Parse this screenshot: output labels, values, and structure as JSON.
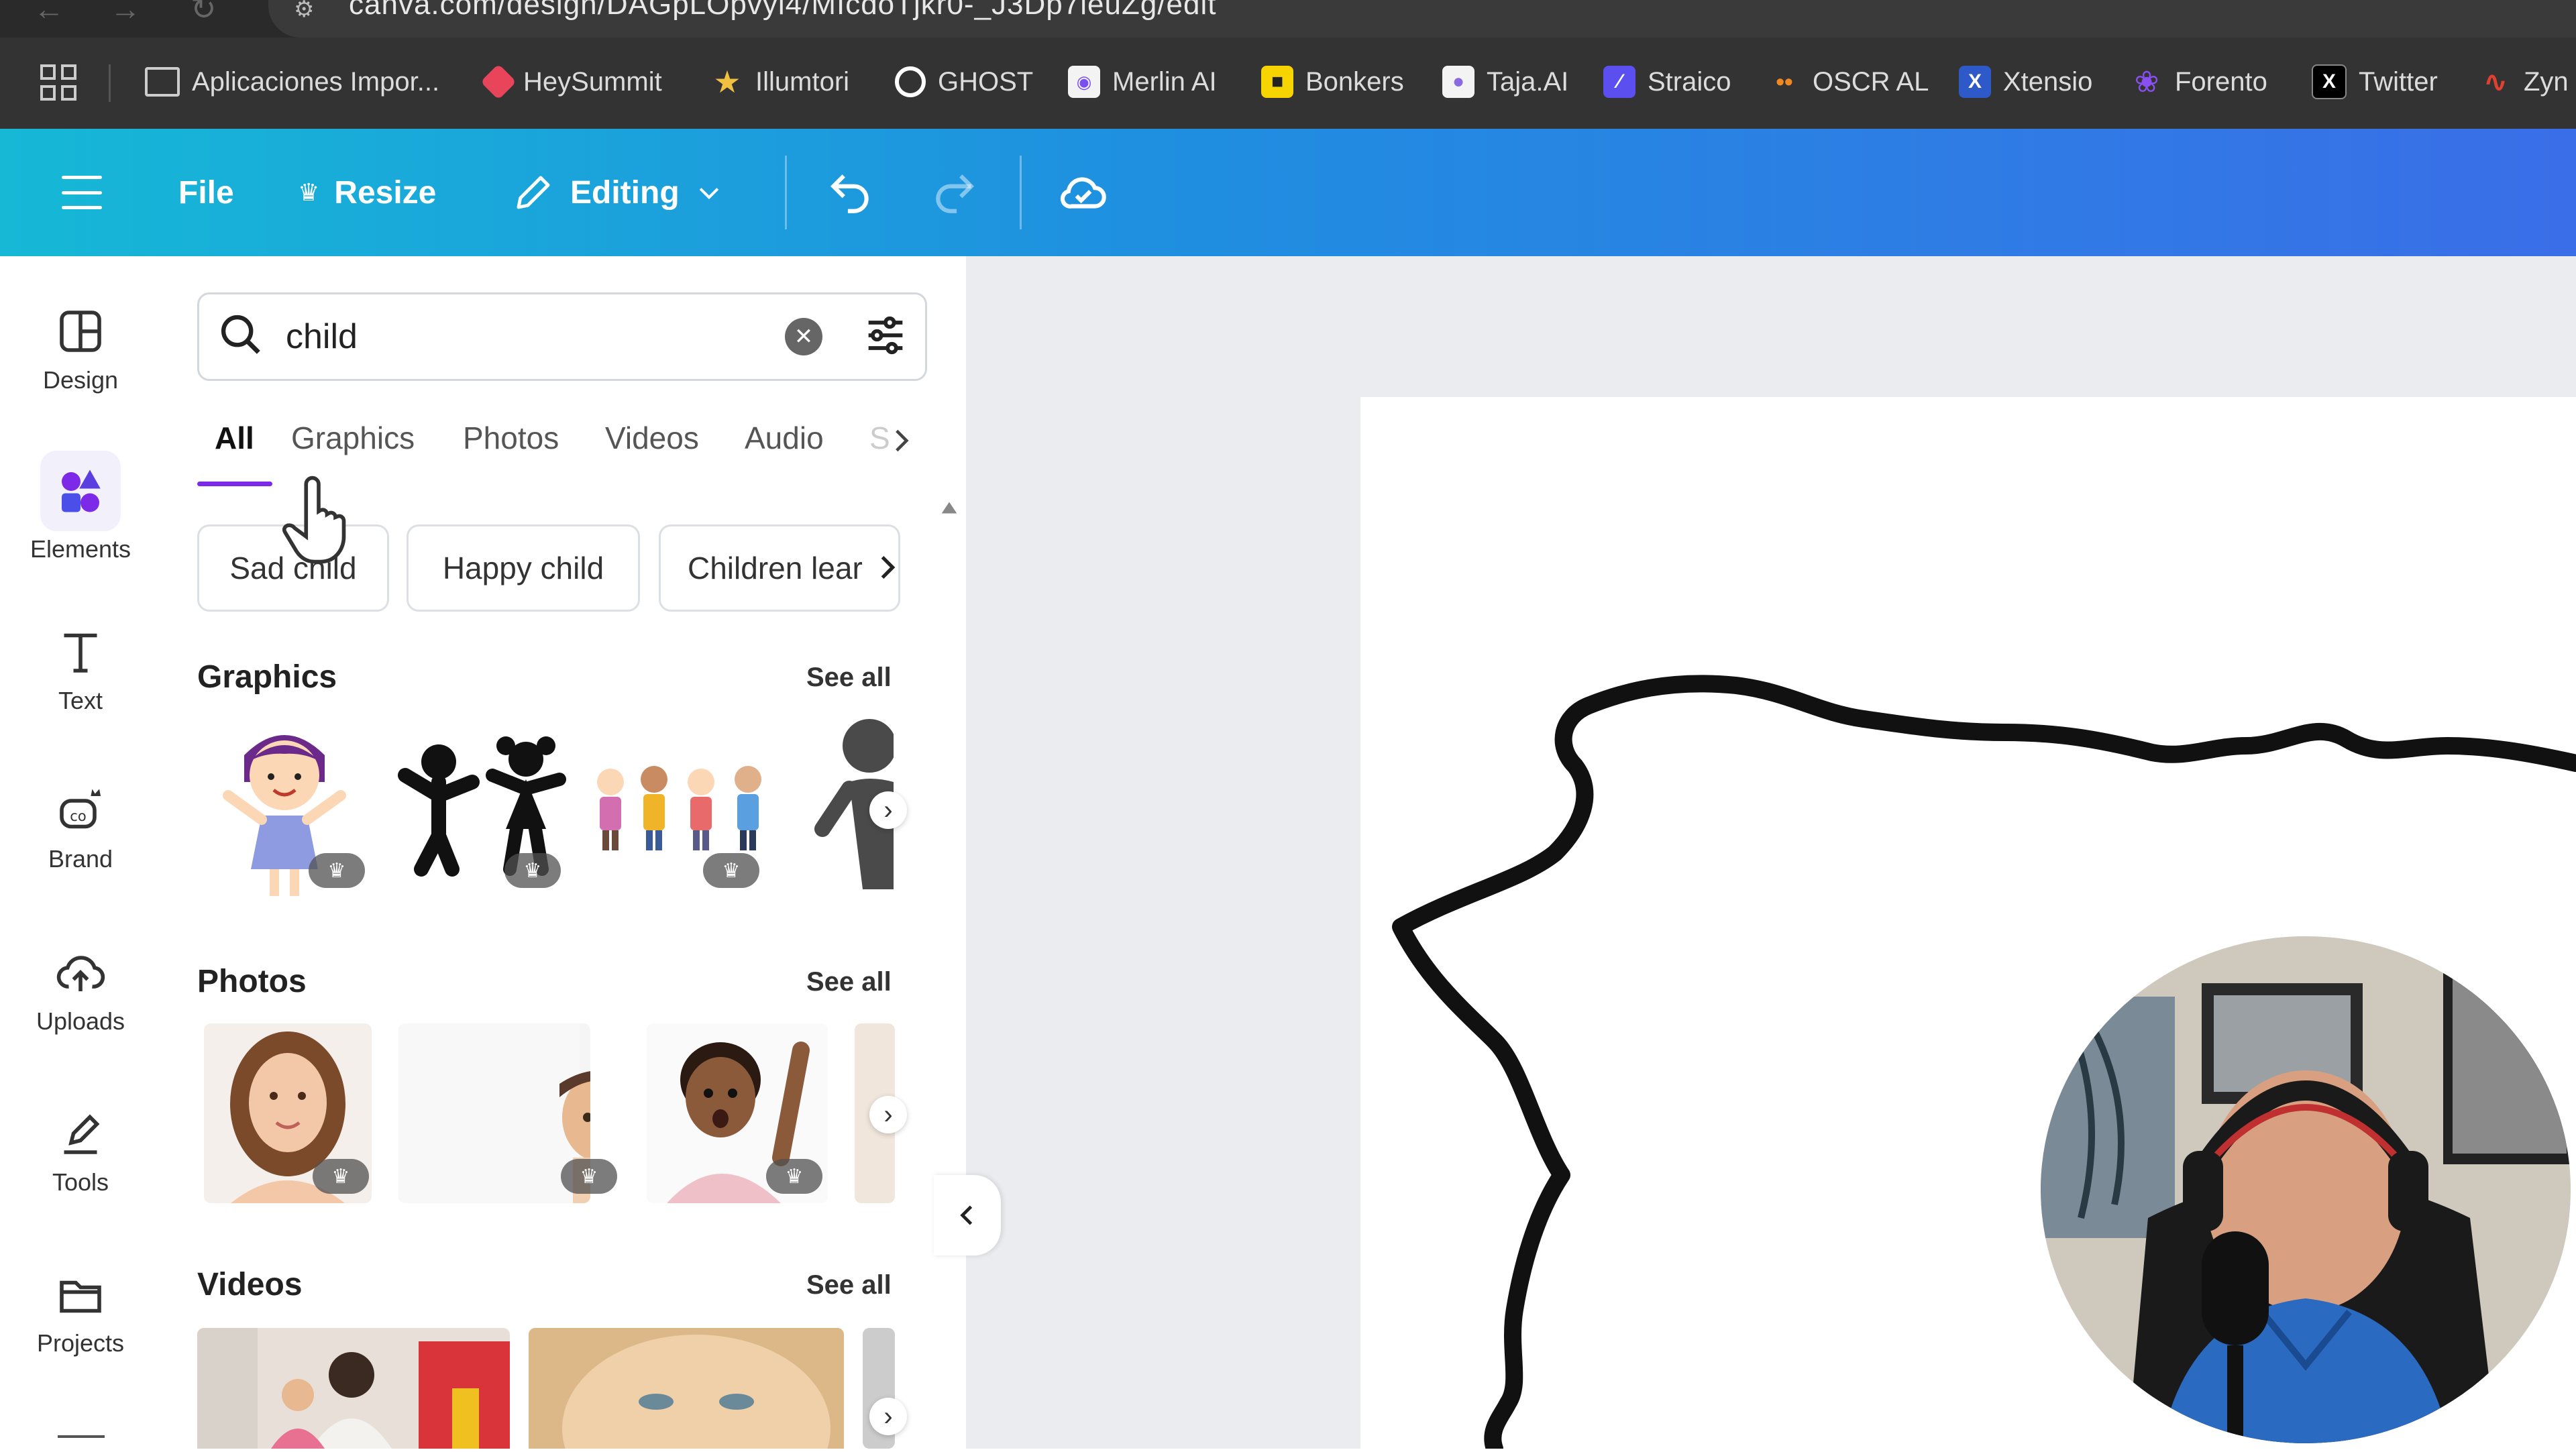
{
  "browser": {
    "url": "canva.com/design/DAGpLOpvyl4/MIcdoTjkr0-_J3Dp7leuZg/edit",
    "bookmarks": [
      {
        "label": "Aplicaciones Impor...",
        "icon": "folder-icon",
        "color": "#cccccc"
      },
      {
        "label": "HeySummit",
        "icon": "heysummit-icon",
        "color": "#e8455a"
      },
      {
        "label": "Illumtori",
        "icon": "star-icon",
        "color": "#f0c040"
      },
      {
        "label": "GHOST",
        "icon": "ghost-icon",
        "color": "#ffffff"
      },
      {
        "label": "Merlin AI",
        "icon": "merlin-icon",
        "color": "#f3f3f3"
      },
      {
        "label": "Bonkers",
        "icon": "bonkers-icon",
        "color": "#f5d400"
      },
      {
        "label": "Taja.AI",
        "icon": "taja-icon",
        "color": "#8a6ae0"
      },
      {
        "label": "Straico",
        "icon": "straico-icon",
        "color": "#5b4ff0"
      },
      {
        "label": "OSCR AL",
        "icon": "oscr-icon",
        "color": "#f08a20"
      },
      {
        "label": "Xtensio",
        "icon": "xtensio-icon",
        "color": "#2d5ac8"
      },
      {
        "label": "Forento",
        "icon": "forento-icon",
        "color": "#8a4ff0"
      },
      {
        "label": "Twitter",
        "icon": "x-twitter-icon",
        "color": "#000000"
      },
      {
        "label": "Zyn",
        "icon": "zyn-icon",
        "color": "#e04030"
      }
    ]
  },
  "topbar": {
    "file_label": "File",
    "resize_label": "Resize",
    "editing_label": "Editing"
  },
  "rail": {
    "items": [
      {
        "label": "Design",
        "icon": "design-layout-icon"
      },
      {
        "label": "Elements",
        "icon": "elements-shapes-icon"
      },
      {
        "label": "Text",
        "icon": "text-t-icon"
      },
      {
        "label": "Brand",
        "icon": "brand-icon"
      },
      {
        "label": "Uploads",
        "icon": "cloud-upload-icon"
      },
      {
        "label": "Tools",
        "icon": "tools-pen-icon"
      },
      {
        "label": "Projects",
        "icon": "folder-icon"
      }
    ]
  },
  "search": {
    "value": "child"
  },
  "tabs": [
    {
      "label": "All"
    },
    {
      "label": "Graphics"
    },
    {
      "label": "Photos"
    },
    {
      "label": "Videos"
    },
    {
      "label": "Audio"
    },
    {
      "label": "S"
    }
  ],
  "chips": [
    {
      "label": "Sad child"
    },
    {
      "label": "Happy child"
    },
    {
      "label": "Children lear"
    }
  ],
  "sections": {
    "graphics": {
      "title": "Graphics",
      "see_all": "See all"
    },
    "photos": {
      "title": "Photos",
      "see_all": "See all"
    },
    "videos": {
      "title": "Videos",
      "see_all": "See all"
    }
  },
  "colors": {
    "accent": "#7d2ae8",
    "topbar_start": "#16b8d6",
    "topbar_end": "#3a6ee8"
  }
}
